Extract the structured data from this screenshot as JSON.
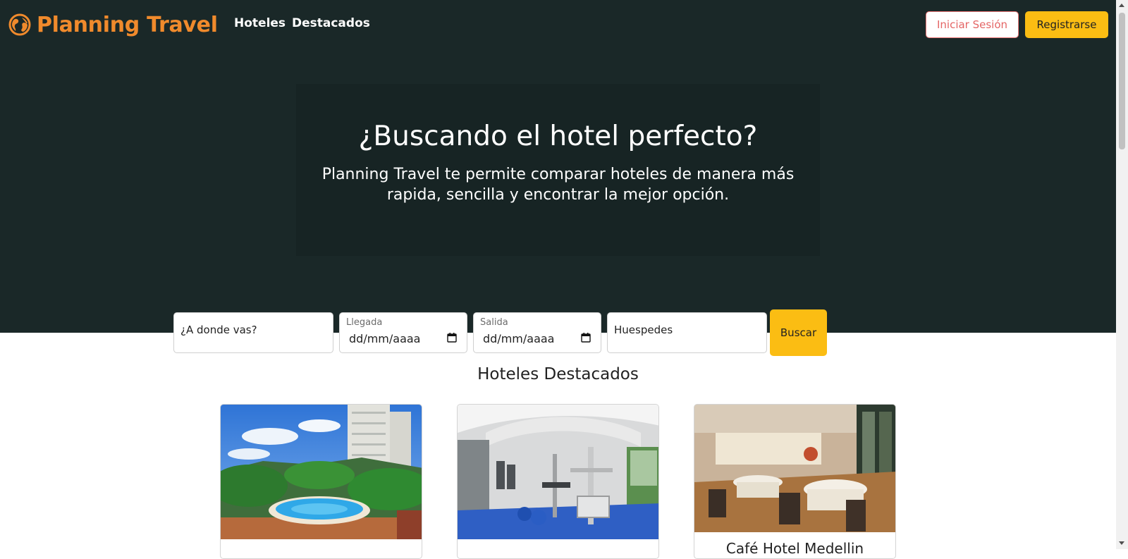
{
  "header": {
    "brand": "Planning Travel",
    "brand_icon": "globe-icon",
    "nav": [
      {
        "label": "Hoteles"
      },
      {
        "label": "Destacados"
      }
    ],
    "login_label": "Iniciar Sesión",
    "register_label": "Registrarse"
  },
  "hero": {
    "title": "¿Buscando el hotel perfecto?",
    "subtitle": "Planning Travel te permite comparar hoteles de manera más rapida, sencilla y encontrar la mejor opción."
  },
  "search": {
    "destination_placeholder": "¿A donde vas?",
    "checkin_label": "Llegada",
    "checkin_placeholder": "dd/mm/aaaa",
    "checkout_label": "Salida",
    "checkout_placeholder": "dd/mm/aaaa",
    "guests_placeholder": "Huespedes",
    "button_label": "Buscar",
    "calendar_icon": "calendar-icon"
  },
  "featured": {
    "title": "Hoteles Destacados",
    "cards": [
      {
        "image": "hotel-pool-photo",
        "name": ""
      },
      {
        "image": "hotel-gym-photo",
        "name": ""
      },
      {
        "image": "hotel-restaurant-photo",
        "name": "Café Hotel Medellin"
      }
    ]
  },
  "colors": {
    "header_bg": "#1a2828",
    "brand": "#f08a2c",
    "accent": "#fbbd13",
    "login_border": "#f07a7a"
  }
}
